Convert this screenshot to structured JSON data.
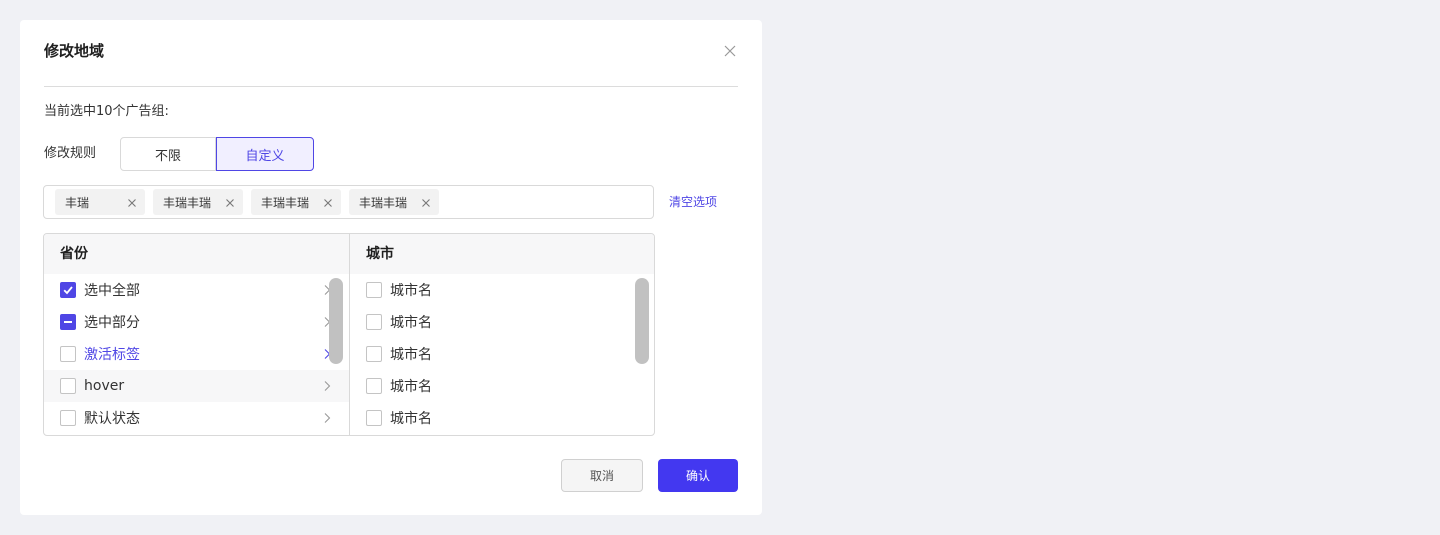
{
  "dialog": {
    "title": "修改地域",
    "selected_count_text": "当前选中10个广告组:",
    "rule_label": "修改规则",
    "rule_options": [
      "不限",
      "自定义"
    ],
    "rule_selected": "自定义",
    "tags": [
      "丰瑞",
      "丰瑞丰瑞",
      "丰瑞丰瑞",
      "丰瑞丰瑞"
    ],
    "clear_label": "清空选项",
    "province": {
      "header": "省份",
      "items": [
        {
          "label": "选中全部",
          "state": "checked"
        },
        {
          "label": "选中部分",
          "state": "indeterminate"
        },
        {
          "label": "激活标签",
          "state": "active"
        },
        {
          "label": "hover",
          "state": "hover"
        },
        {
          "label": "默认状态",
          "state": "default"
        }
      ]
    },
    "city": {
      "header": "城市",
      "items": [
        "城市名",
        "城市名",
        "城市名",
        "城市名",
        "城市名"
      ]
    },
    "cancel_label": "取消",
    "confirm_label": "确认"
  },
  "colors": {
    "accent": "#4f46e5",
    "confirm_button": "#4338f0",
    "background": "#f0f1f5"
  }
}
